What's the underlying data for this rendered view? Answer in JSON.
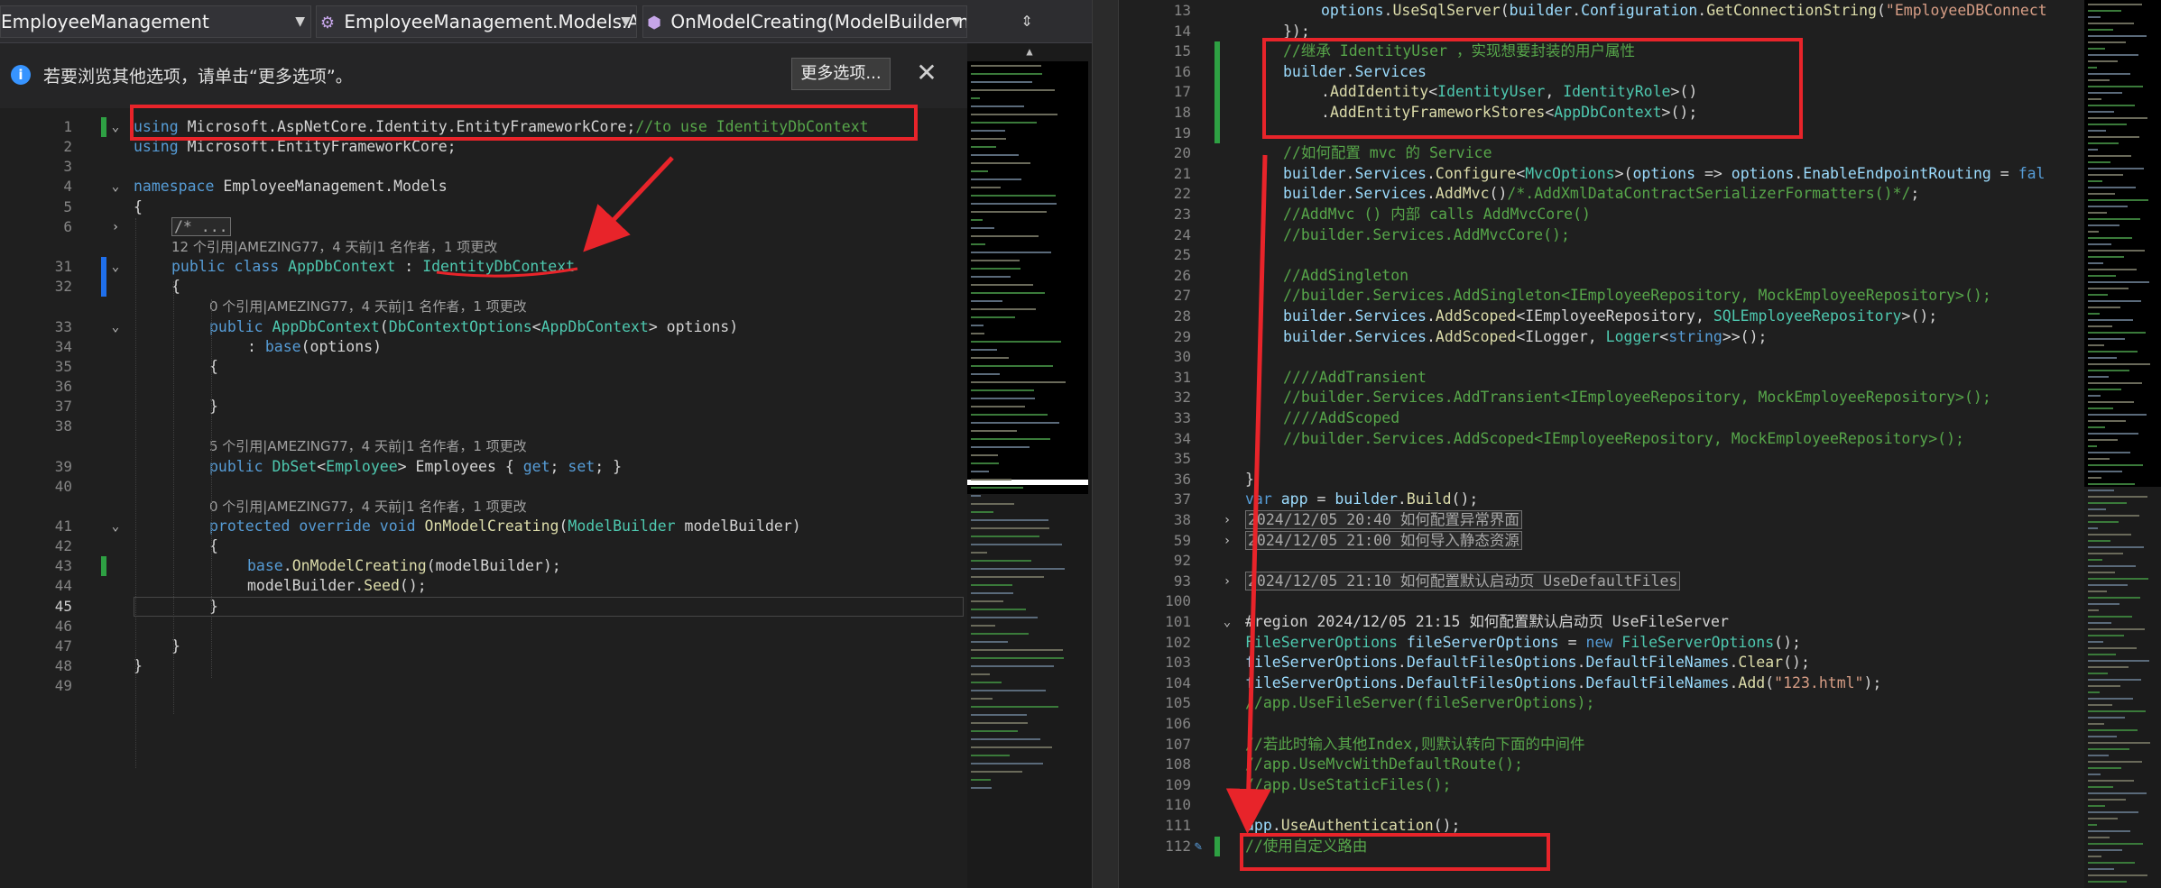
{
  "left_editor": {
    "nav": {
      "project": "EmployeeManagement",
      "class": "EmployeeManagement.Models.App",
      "member": "OnModelCreating(ModelBuilder mo"
    },
    "infobar": {
      "message": "若要浏览其他选项，请单击“更多选项”。",
      "button": "更多选项..."
    },
    "lines": [
      {
        "n": "1",
        "code": [
          [
            "kw",
            "using"
          ],
          [
            "pl",
            " Microsoft.AspNetCore.Identity.EntityFrameworkCore;"
          ],
          [
            "cm",
            "//to use IdentityDbContext"
          ]
        ]
      },
      {
        "n": "2",
        "code": [
          [
            "kw",
            "using"
          ],
          [
            "pl",
            " Microsoft.EntityFrameworkCore;"
          ]
        ]
      },
      {
        "n": "3",
        "code": []
      },
      {
        "n": "4",
        "code": [
          [
            "kw",
            "namespace"
          ],
          [
            "pl",
            " EmployeeManagement.Models"
          ]
        ]
      },
      {
        "n": "5",
        "code": [
          [
            "pl",
            "{"
          ]
        ]
      },
      {
        "n": "6",
        "code": [
          [
            "collapsed",
            "/* ..."
          ]
        ]
      },
      {
        "lens": "12 个引用|AMEZING77，4 天前|1 名作者，1 项更改"
      },
      {
        "n": "31",
        "code": [
          [
            "kw",
            "public"
          ],
          [
            "pl",
            " "
          ],
          [
            "kw",
            "class"
          ],
          [
            "pl",
            " "
          ],
          [
            "cl",
            "AppDbContext"
          ],
          [
            "pl",
            " : "
          ],
          [
            "cl",
            "IdentityDbContext"
          ]
        ]
      },
      {
        "n": "32",
        "code": [
          [
            "pl",
            "{"
          ]
        ]
      },
      {
        "lens": "0 个引用|AMEZING77，4 天前|1 名作者，1 项更改"
      },
      {
        "n": "33",
        "code": [
          [
            "kw",
            "public"
          ],
          [
            "pl",
            " "
          ],
          [
            "cl",
            "AppDbContext"
          ],
          [
            "pl",
            "("
          ],
          [
            "cl",
            "DbContextOptions"
          ],
          [
            "pl",
            "<"
          ],
          [
            "cl",
            "AppDbContext"
          ],
          [
            "pl",
            "> options)"
          ]
        ]
      },
      {
        "n": "34",
        "code": [
          [
            "pl",
            ": "
          ],
          [
            "kw",
            "base"
          ],
          [
            "pl",
            "(options)"
          ]
        ]
      },
      {
        "n": "35",
        "code": [
          [
            "pl",
            "{"
          ]
        ]
      },
      {
        "n": "36",
        "code": []
      },
      {
        "n": "37",
        "code": [
          [
            "pl",
            "}"
          ]
        ]
      },
      {
        "n": "38",
        "code": []
      },
      {
        "lens": "5 个引用|AMEZING77，4 天前|1 名作者，1 项更改"
      },
      {
        "n": "39",
        "code": [
          [
            "kw",
            "public"
          ],
          [
            "pl",
            " "
          ],
          [
            "cl",
            "DbSet"
          ],
          [
            "pl",
            "<"
          ],
          [
            "cl",
            "Employee"
          ],
          [
            "pl",
            "> Employees { "
          ],
          [
            "kw",
            "get"
          ],
          [
            "pl",
            "; "
          ],
          [
            "kw",
            "set"
          ],
          [
            "pl",
            "; }"
          ]
        ]
      },
      {
        "n": "40",
        "code": []
      },
      {
        "lens": "0 个引用|AMEZING77，4 天前|1 名作者，1 项更改"
      },
      {
        "n": "41",
        "code": [
          [
            "kw",
            "protected"
          ],
          [
            "pl",
            " "
          ],
          [
            "kw",
            "override"
          ],
          [
            "pl",
            " "
          ],
          [
            "kw",
            "void"
          ],
          [
            "pl",
            " "
          ],
          [
            "fn",
            "OnModelCreating"
          ],
          [
            "pl",
            "("
          ],
          [
            "cl",
            "ModelBuilder"
          ],
          [
            "pl",
            " modelBuilder)"
          ]
        ]
      },
      {
        "n": "42",
        "code": [
          [
            "pl",
            "{"
          ]
        ]
      },
      {
        "n": "43",
        "code": [
          [
            "kw",
            "base"
          ],
          [
            "pl",
            "."
          ],
          [
            "fn",
            "OnModelCreating"
          ],
          [
            "pl",
            "(modelBuilder);"
          ]
        ]
      },
      {
        "n": "44",
        "code": [
          [
            "pl",
            "modelBuilder."
          ],
          [
            "fn",
            "Seed"
          ],
          [
            "pl",
            "();"
          ]
        ]
      },
      {
        "n": "45",
        "code": [
          [
            "pl",
            "}"
          ]
        ]
      },
      {
        "n": "46",
        "code": []
      },
      {
        "n": "47",
        "code": [
          [
            "pl",
            "}"
          ]
        ]
      },
      {
        "n": "48",
        "code": [
          [
            "pl",
            "}"
          ]
        ]
      },
      {
        "n": "49",
        "code": []
      }
    ]
  },
  "right_editor": {
    "lines": [
      {
        "n": "13",
        "code": [
          [
            "pr",
            "options"
          ],
          [
            "pl",
            "."
          ],
          [
            "fn",
            "UseSqlServer"
          ],
          [
            "pl",
            "("
          ],
          [
            "pr",
            "builder"
          ],
          [
            "pl",
            "."
          ],
          [
            "pr",
            "Configuration"
          ],
          [
            "pl",
            "."
          ],
          [
            "fn",
            "GetConnectionString"
          ],
          [
            "pl",
            "("
          ],
          [
            "st",
            "\"EmployeeDBConnect"
          ]
        ]
      },
      {
        "n": "14",
        "code": [
          [
            "pl",
            "});"
          ]
        ]
      },
      {
        "n": "15",
        "code": [
          [
            "cm",
            "//继承 IdentityUser ，实现想要封装的用户属性"
          ]
        ]
      },
      {
        "n": "16",
        "code": [
          [
            "pr",
            "builder"
          ],
          [
            "pl",
            "."
          ],
          [
            "pr",
            "Services"
          ]
        ]
      },
      {
        "n": "17",
        "code": [
          [
            "pl",
            "."
          ],
          [
            "fn",
            "AddIdentity"
          ],
          [
            "pl",
            "<"
          ],
          [
            "cl",
            "IdentityUser"
          ],
          [
            "pl",
            ", "
          ],
          [
            "cl",
            "IdentityRole"
          ],
          [
            "pl",
            ">()"
          ]
        ]
      },
      {
        "n": "18",
        "code": [
          [
            "pl",
            "."
          ],
          [
            "fn",
            "AddEntityFrameworkStores"
          ],
          [
            "pl",
            "<"
          ],
          [
            "cl",
            "AppDbContext"
          ],
          [
            "pl",
            ">();"
          ]
        ]
      },
      {
        "n": "19",
        "code": []
      },
      {
        "n": "20",
        "code": [
          [
            "cm",
            "//如何配置 mvc 的 Service"
          ]
        ]
      },
      {
        "n": "21",
        "code": [
          [
            "pr",
            "builder"
          ],
          [
            "pl",
            "."
          ],
          [
            "pr",
            "Services"
          ],
          [
            "pl",
            "."
          ],
          [
            "fn",
            "Configure"
          ],
          [
            "pl",
            "<"
          ],
          [
            "cl",
            "MvcOptions"
          ],
          [
            "pl",
            ">("
          ],
          [
            "pr",
            "options"
          ],
          [
            "pl",
            " => "
          ],
          [
            "pr",
            "options"
          ],
          [
            "pl",
            "."
          ],
          [
            "pr",
            "EnableEndpointRouting"
          ],
          [
            "pl",
            " = "
          ],
          [
            "kw",
            "fal"
          ]
        ]
      },
      {
        "n": "22",
        "code": [
          [
            "pr",
            "builder"
          ],
          [
            "pl",
            "."
          ],
          [
            "pr",
            "Services"
          ],
          [
            "pl",
            "."
          ],
          [
            "fn",
            "AddMvc"
          ],
          [
            "pl",
            "()"
          ],
          [
            "cm",
            "/*.AddXmlDataContractSerializerFormatters()*/"
          ],
          [
            "pl",
            ";"
          ]
        ]
      },
      {
        "n": "23",
        "code": [
          [
            "cm",
            "//AddMvc () 内部 calls AddMvcCore()"
          ]
        ]
      },
      {
        "n": "24",
        "code": [
          [
            "cm",
            "//builder.Services.AddMvcCore();"
          ]
        ]
      },
      {
        "n": "25",
        "code": []
      },
      {
        "n": "26",
        "code": [
          [
            "cm",
            "//AddSingleton"
          ]
        ]
      },
      {
        "n": "27",
        "code": [
          [
            "cm",
            "//builder.Services.AddSingleton<IEmployeeRepository, MockEmployeeRepository>();"
          ]
        ]
      },
      {
        "n": "28",
        "code": [
          [
            "pr",
            "builder"
          ],
          [
            "pl",
            "."
          ],
          [
            "pr",
            "Services"
          ],
          [
            "pl",
            "."
          ],
          [
            "fn",
            "AddScoped"
          ],
          [
            "pl",
            "<IEmployeeRepository, "
          ],
          [
            "cl",
            "SQLEmployeeRepository"
          ],
          [
            "pl",
            ">();"
          ]
        ]
      },
      {
        "n": "29",
        "code": [
          [
            "pr",
            "builder"
          ],
          [
            "pl",
            "."
          ],
          [
            "pr",
            "Services"
          ],
          [
            "pl",
            "."
          ],
          [
            "fn",
            "AddScoped"
          ],
          [
            "pl",
            "<ILogger, "
          ],
          [
            "cl",
            "Logger"
          ],
          [
            "pl",
            "<"
          ],
          [
            "kw",
            "string"
          ],
          [
            "pl",
            ">>();"
          ]
        ]
      },
      {
        "n": "30",
        "code": []
      },
      {
        "n": "31",
        "code": [
          [
            "cm",
            "////AddTransient"
          ]
        ]
      },
      {
        "n": "32",
        "code": [
          [
            "cm",
            "//builder.Services.AddTransient<IEmployeeRepository, MockEmployeeRepository>();"
          ]
        ]
      },
      {
        "n": "33",
        "code": [
          [
            "cm",
            "////AddScoped"
          ]
        ]
      },
      {
        "n": "34",
        "code": [
          [
            "cm",
            "//builder.Services.AddScoped<IEmployeeRepository, MockEmployeeRepository>();"
          ]
        ]
      },
      {
        "n": "35",
        "code": []
      },
      {
        "n": "36",
        "code": [
          [
            "pl",
            "}"
          ]
        ]
      },
      {
        "n": "37",
        "code": [
          [
            "kw",
            "var"
          ],
          [
            "pl",
            " "
          ],
          [
            "pr",
            "app"
          ],
          [
            "pl",
            " = "
          ],
          [
            "pr",
            "builder"
          ],
          [
            "pl",
            "."
          ],
          [
            "fn",
            "Build"
          ],
          [
            "pl",
            "();"
          ]
        ]
      },
      {
        "n": "38",
        "code": [
          [
            "collapsed",
            "2024/12/05 20:40 如何配置异常界面"
          ]
        ]
      },
      {
        "n": "59",
        "code": [
          [
            "collapsed",
            "2024/12/05 21:00 如何导入静态资源"
          ]
        ]
      },
      {
        "n": "92",
        "code": []
      },
      {
        "n": "93",
        "code": [
          [
            "collapsed",
            "2024/12/05 21:10 如何配置默认启动页 UseDefaultFiles"
          ]
        ]
      },
      {
        "n": "100",
        "code": []
      },
      {
        "n": "101",
        "code": [
          [
            "rg",
            "#region 2024/12/05 21:15 如何配置默认启动页 UseFileServer"
          ]
        ]
      },
      {
        "n": "102",
        "code": [
          [
            "cl",
            "FileServerOptions"
          ],
          [
            "pl",
            " "
          ],
          [
            "pr",
            "fileServerOptions"
          ],
          [
            "pl",
            " = "
          ],
          [
            "kw",
            "new"
          ],
          [
            "pl",
            " "
          ],
          [
            "cl",
            "FileServerOptions"
          ],
          [
            "pl",
            "();"
          ]
        ]
      },
      {
        "n": "103",
        "code": [
          [
            "pr",
            "fileServerOptions"
          ],
          [
            "pl",
            "."
          ],
          [
            "pr",
            "DefaultFilesOptions"
          ],
          [
            "pl",
            "."
          ],
          [
            "pr",
            "DefaultFileNames"
          ],
          [
            "pl",
            "."
          ],
          [
            "fn",
            "Clear"
          ],
          [
            "pl",
            "();"
          ]
        ]
      },
      {
        "n": "104",
        "code": [
          [
            "pr",
            "fileServerOptions"
          ],
          [
            "pl",
            "."
          ],
          [
            "pr",
            "DefaultFilesOptions"
          ],
          [
            "pl",
            "."
          ],
          [
            "pr",
            "DefaultFileNames"
          ],
          [
            "pl",
            "."
          ],
          [
            "fn",
            "Add"
          ],
          [
            "pl",
            "("
          ],
          [
            "st",
            "\"123.html\""
          ],
          [
            "pl",
            ");"
          ]
        ]
      },
      {
        "n": "105",
        "code": [
          [
            "cm",
            "//app.UseFileServer(fileServerOptions);"
          ]
        ]
      },
      {
        "n": "106",
        "code": []
      },
      {
        "n": "107",
        "code": [
          [
            "cm",
            "//若此时输入其他Index,则默认转向下面的中间件"
          ]
        ]
      },
      {
        "n": "108",
        "code": [
          [
            "cm",
            "//app.UseMvcWithDefaultRoute();"
          ]
        ]
      },
      {
        "n": "109",
        "code": [
          [
            "cm",
            "//app.UseStaticFiles();"
          ]
        ]
      },
      {
        "n": "110",
        "code": []
      },
      {
        "n": "111",
        "code": [
          [
            "pr",
            "app"
          ],
          [
            "pl",
            "."
          ],
          [
            "fn",
            "UseAuthentication"
          ],
          [
            "pl",
            "();"
          ]
        ]
      },
      {
        "n": "112",
        "code": [
          [
            "cm",
            "//使用自定义路由"
          ]
        ]
      }
    ]
  },
  "colors": {
    "background": "#1f1f1f",
    "annotation": "#e8242a",
    "keyword": "#569cd6",
    "type": "#4ec9b0",
    "comment": "#57a64a",
    "method": "#dcdcaa",
    "string": "#d69d85",
    "change_marker": "#2ea043"
  },
  "icons": [
    "info-icon",
    "close-icon",
    "split-editor-icon",
    "fold-chevron-icon",
    "quick-action-icon"
  ]
}
